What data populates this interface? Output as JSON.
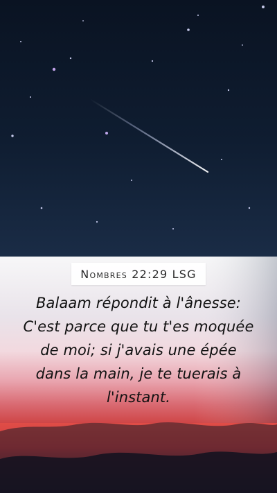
{
  "reference": "Nombres 22:29 LSG",
  "verse_text": "Balaam répondit à l'ânesse: C'est parce que tu t'es moquée de moi; si j'avais une épée dans la main, je te tuerais à l'instant.",
  "colors": {
    "sky_top": "#0a1322",
    "sky_bottom": "#1a2c46",
    "sunset_red": "#d93b3b",
    "panel_white": "#ffffff",
    "text_dark": "#111111"
  }
}
